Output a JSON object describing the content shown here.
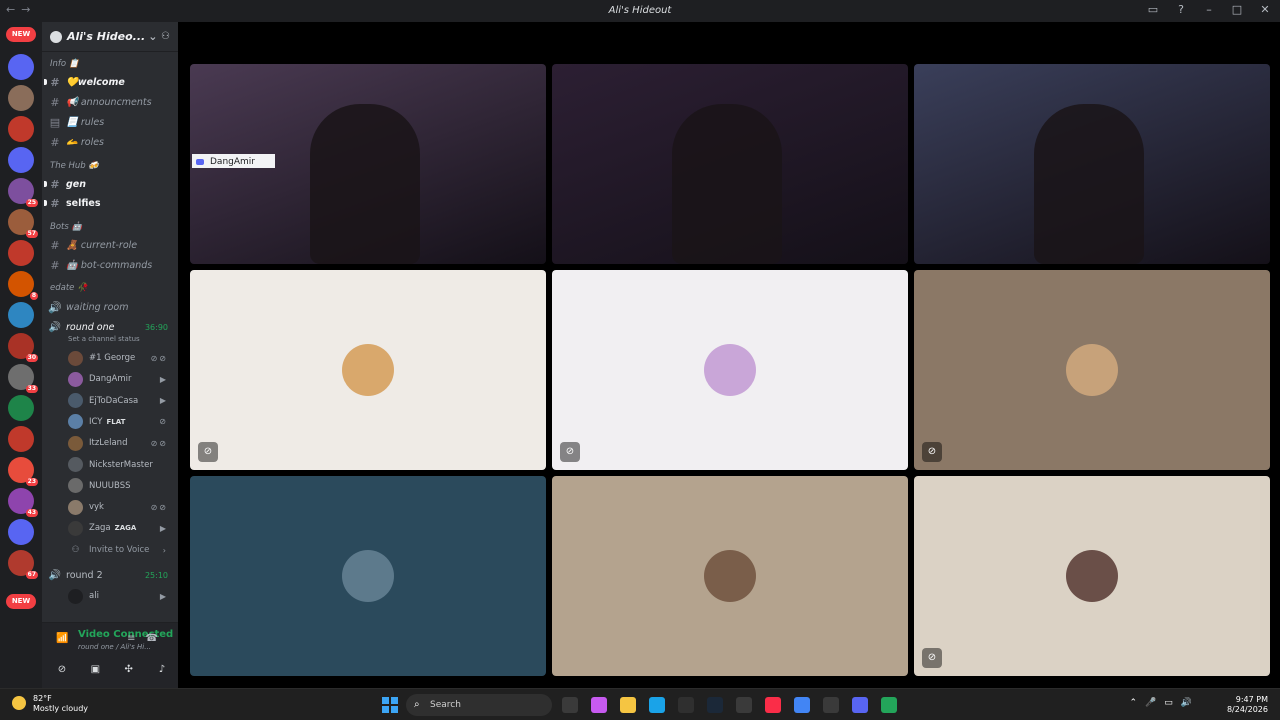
{
  "window": {
    "title": "Ali's Hideout"
  },
  "guild": {
    "name": "Ali's Hideo..."
  },
  "servers": [
    {
      "color": "#5865f2",
      "badge": ""
    },
    {
      "color": "#8a6d5a",
      "badge": ""
    },
    {
      "color": "#c0392b",
      "badge": ""
    },
    {
      "color": "#5865f2",
      "badge": ""
    },
    {
      "color": "#7d4f9e",
      "badge": "25"
    },
    {
      "color": "#9b5d3c",
      "badge": "57"
    },
    {
      "color": "#c0392b",
      "badge": ""
    },
    {
      "color": "#d35400",
      "badge": "8"
    },
    {
      "color": "#2e86c1",
      "badge": ""
    },
    {
      "color": "#a93226",
      "badge": "30"
    },
    {
      "color": "#6e6e6e",
      "badge": "33"
    },
    {
      "color": "#1e8449",
      "badge": ""
    },
    {
      "color": "#c0392b",
      "badge": ""
    },
    {
      "color": "#e74c3c",
      "badge": "23"
    },
    {
      "color": "#8e44ad",
      "badge": "43"
    },
    {
      "color": "#5865f2",
      "badge": ""
    },
    {
      "color": "#b03a2e",
      "badge": "67"
    }
  ],
  "new_label": "NEW",
  "sidebar": {
    "cat_info": "Info 📋",
    "welcome": "💛welcome",
    "announcements": "📢 announcments",
    "rules": "📃 rules",
    "roles": "🫴 roles",
    "cat_hub": "The Hub 🍻",
    "gen": "gen",
    "selfies": "selfies",
    "cat_bots": "Bots 🤖",
    "current_role": "🧸 current-role",
    "bot_commands": "🤖 bot-commands",
    "cat_edate": "edate 🥀",
    "waiting_room": "waiting room",
    "round_one": "round one",
    "round_one_time": "36:90",
    "channel_status": "Set a channel status",
    "round_two": "round 2",
    "round_two_time": "25:10",
    "invite": "Invite to Voice"
  },
  "voice_users": [
    {
      "name": "#1 George",
      "tag": "",
      "icons": "⊘⊘"
    },
    {
      "name": "DangAmir",
      "tag": "",
      "icons": "▶"
    },
    {
      "name": "EjToDaCasa",
      "tag": "",
      "icons": "▶"
    },
    {
      "name": "ICY",
      "tag": "FLAT",
      "icons": "⊘"
    },
    {
      "name": "ItzLeland",
      "tag": "",
      "icons": "⊘⊘"
    },
    {
      "name": "NicksterMaster",
      "tag": "",
      "icons": ""
    },
    {
      "name": "NUUUBSS",
      "tag": "",
      "icons": ""
    },
    {
      "name": "vyk",
      "tag": "",
      "icons": "⊘⊘"
    },
    {
      "name": "Zaga",
      "tag": "ZAGA",
      "icons": "▶"
    }
  ],
  "round2_users": [
    {
      "name": "ali",
      "icons": "▶"
    }
  ],
  "voice_panel": {
    "status": "Video Connected",
    "sub": "round one / Ali's Hi..."
  },
  "tiles": [
    {
      "kind": "video",
      "bg": "#4a3a52",
      "nametag": "DangAmir"
    },
    {
      "kind": "video",
      "bg": "#2c1f33",
      "nametag": ""
    },
    {
      "kind": "video",
      "bg": "#3a3f5a",
      "nametag": ""
    },
    {
      "kind": "avatar",
      "bg": "#efebe6",
      "avatar": "#d9a86c",
      "cam_off": true
    },
    {
      "kind": "avatar",
      "bg": "#f1eff2",
      "avatar": "#c9a6d8",
      "cam_off": true
    },
    {
      "kind": "avatar",
      "bg": "#8b7866",
      "avatar": "#c7a27a",
      "cam_off": true
    },
    {
      "kind": "avatar",
      "bg": "#2b4a5c",
      "avatar": "#5d7a8c",
      "cam_off": false
    },
    {
      "kind": "avatar",
      "bg": "#b4a38e",
      "avatar": "#7a5e4a",
      "cam_off": false
    },
    {
      "kind": "avatar",
      "bg": "#dbd2c5",
      "avatar": "#6a4f48",
      "cam_off": true
    }
  ],
  "taskbar": {
    "temp": "82°F",
    "weather": "Mostly cloudy",
    "search": "Search",
    "time": "9:47 PM",
    "date": "8/24/2026"
  },
  "taskbar_apps": [
    "#3a3a3a",
    "#c75af0",
    "#f5c542",
    "#1aa3e8",
    "#2f2f2f",
    "#1b2838",
    "#3a3a3a",
    "#fa2d48",
    "#4285f4",
    "#3a3a3a",
    "#5865f2",
    "#23a55a"
  ]
}
